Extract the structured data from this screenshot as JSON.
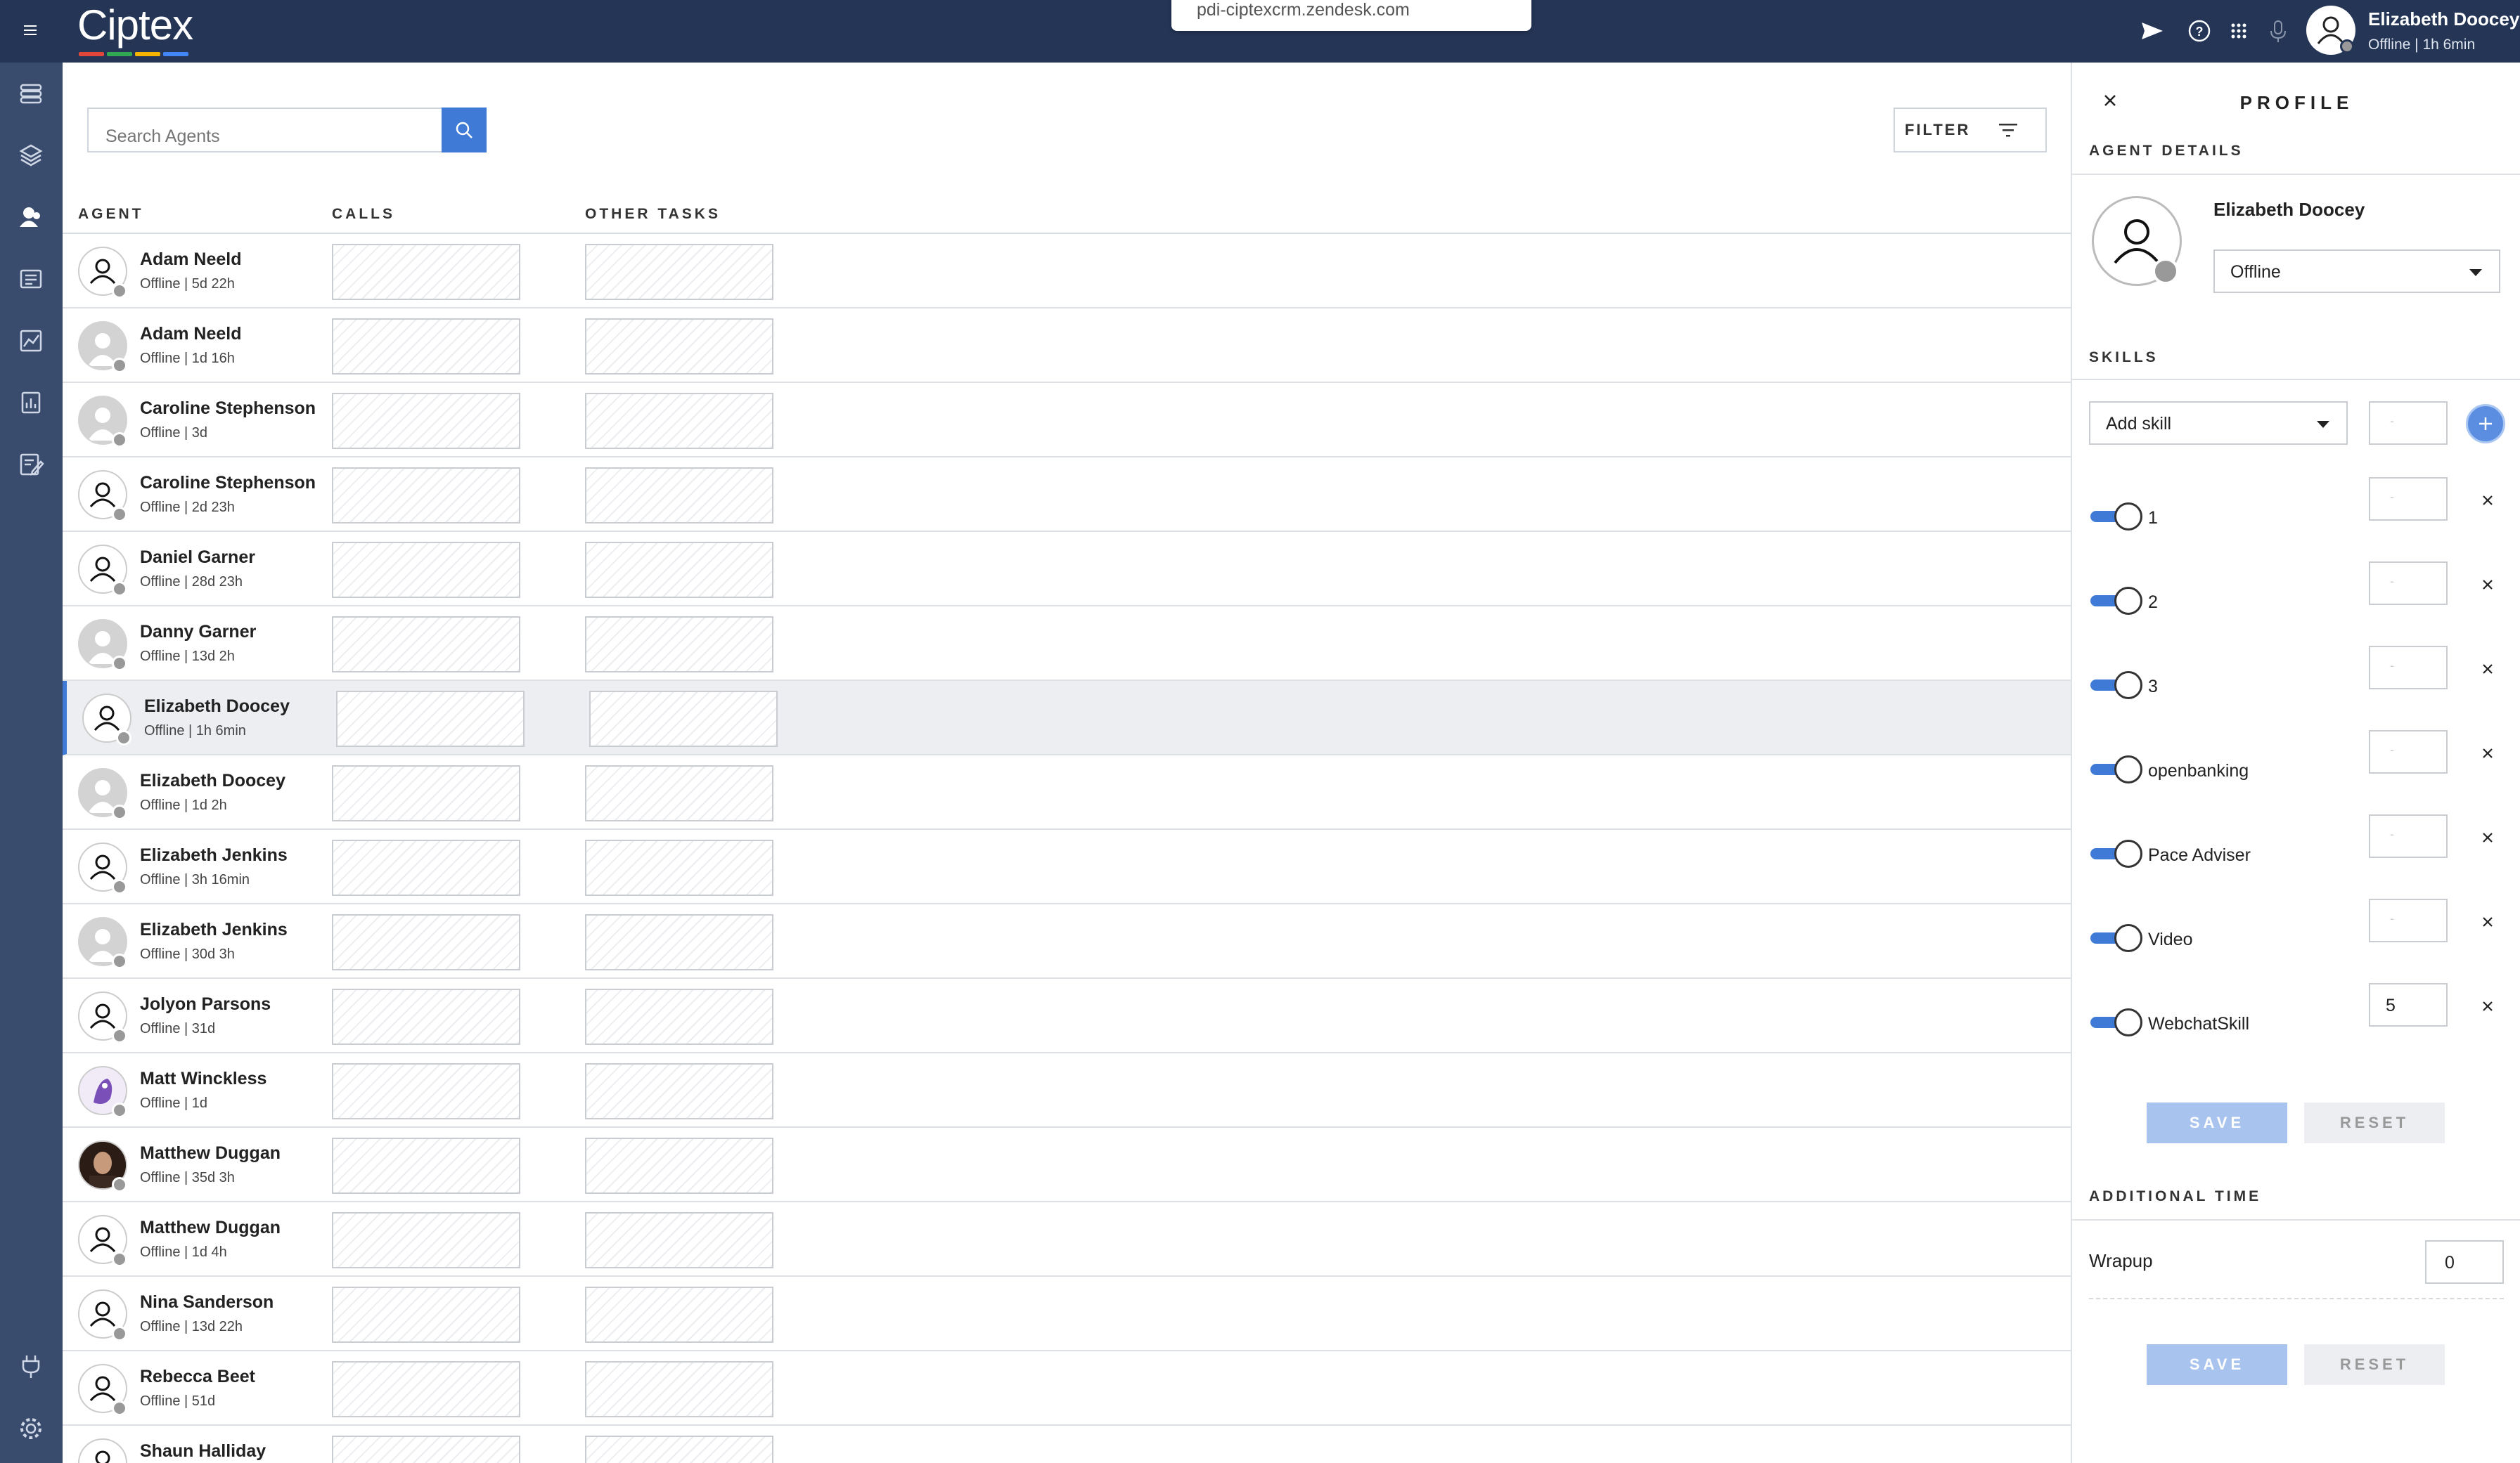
{
  "app": {
    "logo": "Ciptex",
    "url": "pdi-ciptexcrm.zendesk.com",
    "brand_colors": [
      "#e0463a",
      "#33a852",
      "#f4b400",
      "#4285f4"
    ]
  },
  "topbar": {
    "user_name": "Elizabeth Doocey",
    "user_status": "Offline | 1h 6min"
  },
  "toolbar": {
    "search_placeholder": "Search Agents",
    "filter_label": "FILTER"
  },
  "columns": {
    "agent": "AGENT",
    "calls": "CALLS",
    "other_tasks": "OTHER TASKS"
  },
  "agents": [
    {
      "name": "Adam Neeld",
      "status": "Offline | 5d 22h",
      "avatar": "outline"
    },
    {
      "name": "Adam Neeld",
      "status": "Offline | 1d 16h",
      "avatar": "gray"
    },
    {
      "name": "Caroline Stephenson",
      "status": "Offline | 3d",
      "avatar": "gray"
    },
    {
      "name": "Caroline Stephenson",
      "status": "Offline | 2d 23h",
      "avatar": "outline"
    },
    {
      "name": "Daniel Garner",
      "status": "Offline | 28d 23h",
      "avatar": "outline"
    },
    {
      "name": "Danny Garner",
      "status": "Offline | 13d 2h",
      "avatar": "gray"
    },
    {
      "name": "Elizabeth Doocey",
      "status": "Offline | 1h 6min",
      "avatar": "outline",
      "selected": true
    },
    {
      "name": "Elizabeth Doocey",
      "status": "Offline | 1d 2h",
      "avatar": "gray"
    },
    {
      "name": "Elizabeth Jenkins",
      "status": "Offline | 3h 16min",
      "avatar": "outline"
    },
    {
      "name": "Elizabeth Jenkins",
      "status": "Offline | 30d 3h",
      "avatar": "gray"
    },
    {
      "name": "Jolyon Parsons",
      "status": "Offline | 31d",
      "avatar": "outline"
    },
    {
      "name": "Matt Winckless",
      "status": "Offline | 1d",
      "avatar": "art"
    },
    {
      "name": "Matthew Duggan",
      "status": "Offline | 35d 3h",
      "avatar": "photo"
    },
    {
      "name": "Matthew Duggan",
      "status": "Offline | 1d 4h",
      "avatar": "outline"
    },
    {
      "name": "Nina Sanderson",
      "status": "Offline | 13d 22h",
      "avatar": "outline"
    },
    {
      "name": "Rebecca Beet",
      "status": "Offline | 51d",
      "avatar": "outline"
    },
    {
      "name": "Shaun Halliday",
      "status": "",
      "avatar": "outline"
    }
  ],
  "profile": {
    "title": "PROFILE",
    "agent_details_heading": "AGENT DETAILS",
    "name": "Elizabeth Doocey",
    "status_selected": "Offline",
    "skills_heading": "SKILLS",
    "add_skill_placeholder": "Add skill",
    "add_skill_level": "-",
    "skills": [
      {
        "label": "1",
        "level": "-",
        "enabled": true
      },
      {
        "label": "2",
        "level": "-",
        "enabled": true
      },
      {
        "label": "3",
        "level": "-",
        "enabled": true
      },
      {
        "label": "openbanking",
        "level": "-",
        "enabled": true
      },
      {
        "label": "Pace Adviser",
        "level": "-",
        "enabled": true
      },
      {
        "label": "Video",
        "level": "-",
        "enabled": true
      },
      {
        "label": "WebchatSkill",
        "level": "5",
        "enabled": true
      }
    ],
    "save_label": "SAVE",
    "reset_label": "RESET",
    "additional_time_heading": "ADDITIONAL TIME",
    "wrapup_label": "Wrapup",
    "wrapup_value": "0"
  }
}
